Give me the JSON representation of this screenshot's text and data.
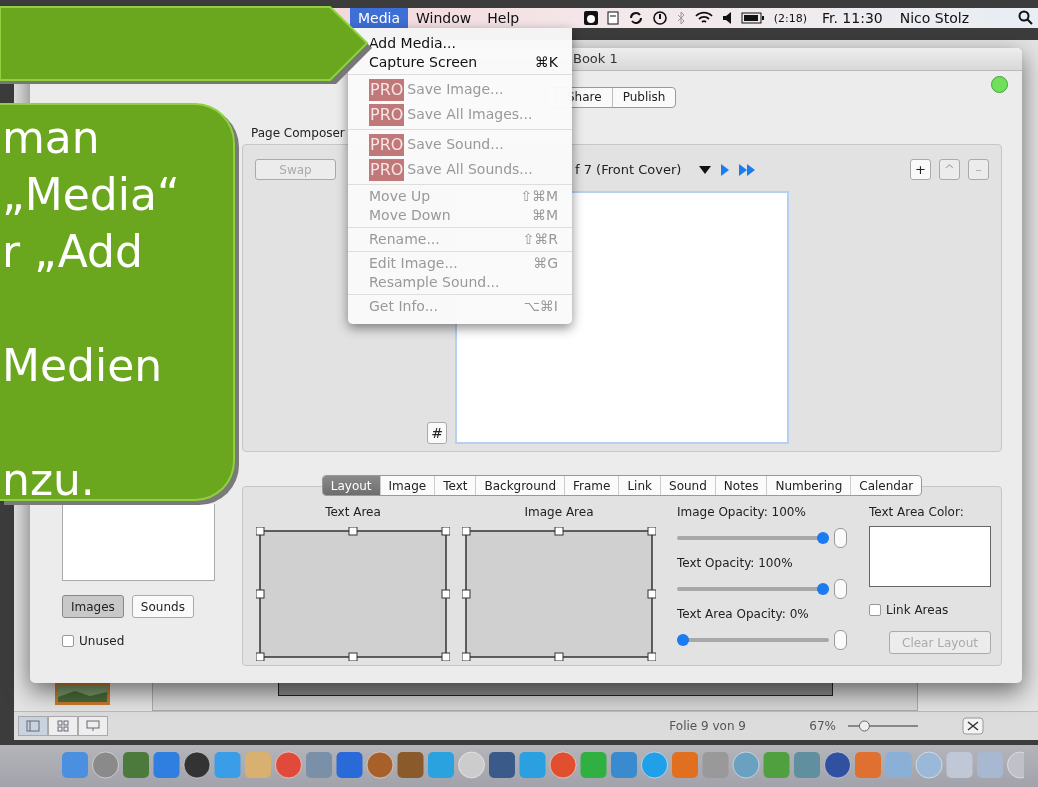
{
  "menu_bar": {
    "menus": [
      {
        "label": "Media",
        "selected": true
      },
      {
        "label": "Window",
        "selected": false
      },
      {
        "label": "Help",
        "selected": false
      }
    ],
    "battery_time": "(2:18)",
    "clock": "Fr. 11:30",
    "user": "Nico Stolz"
  },
  "media_menu": {
    "groups": [
      {
        "items": [
          {
            "label": "Add Media...",
            "enabled": true
          },
          {
            "label": "Capture Screen",
            "shortcut": "⌘K",
            "enabled": true
          }
        ]
      },
      {
        "items": [
          {
            "badge": "PRO",
            "label": "Save Image...",
            "enabled": false
          },
          {
            "badge": "PRO",
            "label": "Save All Images...",
            "enabled": false
          }
        ]
      },
      {
        "items": [
          {
            "badge": "PRO",
            "label": "Save Sound...",
            "enabled": false
          },
          {
            "badge": "PRO",
            "label": "Save All Sounds...",
            "enabled": false
          }
        ]
      },
      {
        "items": [
          {
            "label": "Move Up",
            "shortcut": "⇧⌘M",
            "enabled": false
          },
          {
            "label": "Move Down",
            "shortcut": "⌘M",
            "enabled": false
          }
        ]
      },
      {
        "items": [
          {
            "label": "Rename...",
            "shortcut": "⇧⌘R",
            "enabled": false
          }
        ]
      },
      {
        "items": [
          {
            "label": "Edit Image...",
            "shortcut": "⌘G",
            "enabled": false
          },
          {
            "label": "Resample Sound...",
            "enabled": false
          }
        ]
      },
      {
        "items": [
          {
            "label": "Get Info...",
            "shortcut": "⌥⌘I",
            "enabled": false
          }
        ]
      }
    ]
  },
  "instruction_callout": {
    "paragraphs": [
      {
        "lines": [
          "man",
          "„Media“",
          "r „Add"
        ]
      },
      {
        "lines": [
          "Medien"
        ]
      },
      {
        "lines": [
          "nzu."
        ]
      }
    ]
  },
  "window": {
    "title": "Book 1",
    "toolbar": [
      {
        "label": "Share"
      },
      {
        "label": "Publish"
      }
    ]
  },
  "sidebar": {
    "buttons": [
      {
        "label": "Images",
        "selected": true
      },
      {
        "label": "Sounds",
        "selected": false
      }
    ],
    "unused": {
      "label": "Unused",
      "checked": false
    }
  },
  "page_composer": {
    "title": "Page Composer",
    "swap": {
      "label": "Swap",
      "disabled": true
    },
    "page_indicator": "f 7 (Front Cover)",
    "grid_button": "#",
    "buttons": [
      {
        "label": "+",
        "disabled": false
      },
      {
        "label": "^",
        "disabled": true
      },
      {
        "label": "–",
        "disabled": true
      }
    ]
  },
  "inspector": {
    "tabs": [
      {
        "label": "Layout",
        "selected": true
      },
      {
        "label": "Image",
        "selected": false
      },
      {
        "label": "Text",
        "selected": false
      },
      {
        "label": "Background",
        "selected": false
      },
      {
        "label": "Frame",
        "selected": false
      },
      {
        "label": "Link",
        "selected": false
      },
      {
        "label": "Sound",
        "selected": false
      },
      {
        "label": "Notes",
        "selected": false
      },
      {
        "label": "Numbering",
        "selected": false
      },
      {
        "label": "Calendar",
        "selected": false
      }
    ],
    "text_area_label": "Text Area",
    "image_area_label": "Image Area",
    "sliders": [
      {
        "label": "Image Opacity: 100%",
        "level": 1
      },
      {
        "label": "Text Opacity: 100%",
        "level": 1
      },
      {
        "label": "Text Area Opacity: 0%",
        "level": 0
      }
    ],
    "color_label": "Text Area Color:",
    "link_areas": {
      "label": "Link Areas",
      "checked": false
    },
    "clear": {
      "label": "Clear Layout",
      "disabled": true
    }
  },
  "background_window": {
    "slide_status": "Folie 9 von 9",
    "zoom": "67%",
    "zoom_slider": {
      "level": 0.2
    }
  }
}
